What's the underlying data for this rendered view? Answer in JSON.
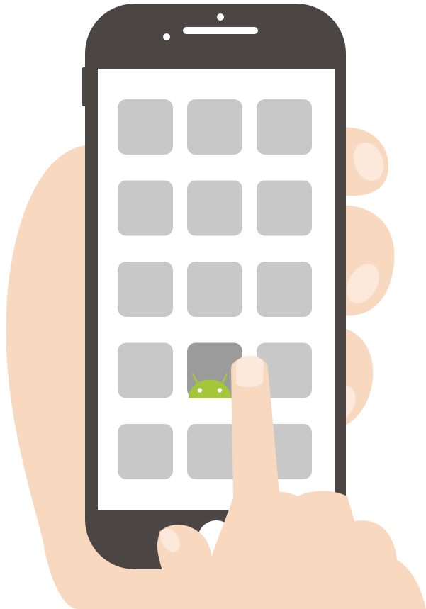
{
  "colors": {
    "phone_body": "#4b4544",
    "screen": "#ffffff",
    "tile": "#c8c8c8",
    "tile_highlighted": "#9b9b9b",
    "android_green": "#a4c639",
    "skin": "#f8d8bf",
    "nail": "#fde8dc"
  },
  "phone": {
    "icons": [
      {
        "name": "app-icon-1",
        "highlighted": false
      },
      {
        "name": "app-icon-2",
        "highlighted": false
      },
      {
        "name": "app-icon-3",
        "highlighted": false
      },
      {
        "name": "app-icon-4",
        "highlighted": false
      },
      {
        "name": "app-icon-5",
        "highlighted": false
      },
      {
        "name": "app-icon-6",
        "highlighted": false
      },
      {
        "name": "app-icon-7",
        "highlighted": false
      },
      {
        "name": "app-icon-8",
        "highlighted": false
      },
      {
        "name": "app-icon-9",
        "highlighted": false
      },
      {
        "name": "app-icon-10",
        "highlighted": false
      },
      {
        "name": "android-app-icon",
        "highlighted": true,
        "icon": "android-robot-icon"
      },
      {
        "name": "app-icon-12",
        "highlighted": false
      },
      {
        "name": "app-icon-13",
        "highlighted": false
      },
      {
        "name": "app-icon-14",
        "highlighted": false
      },
      {
        "name": "app-icon-15",
        "highlighted": false
      }
    ]
  }
}
